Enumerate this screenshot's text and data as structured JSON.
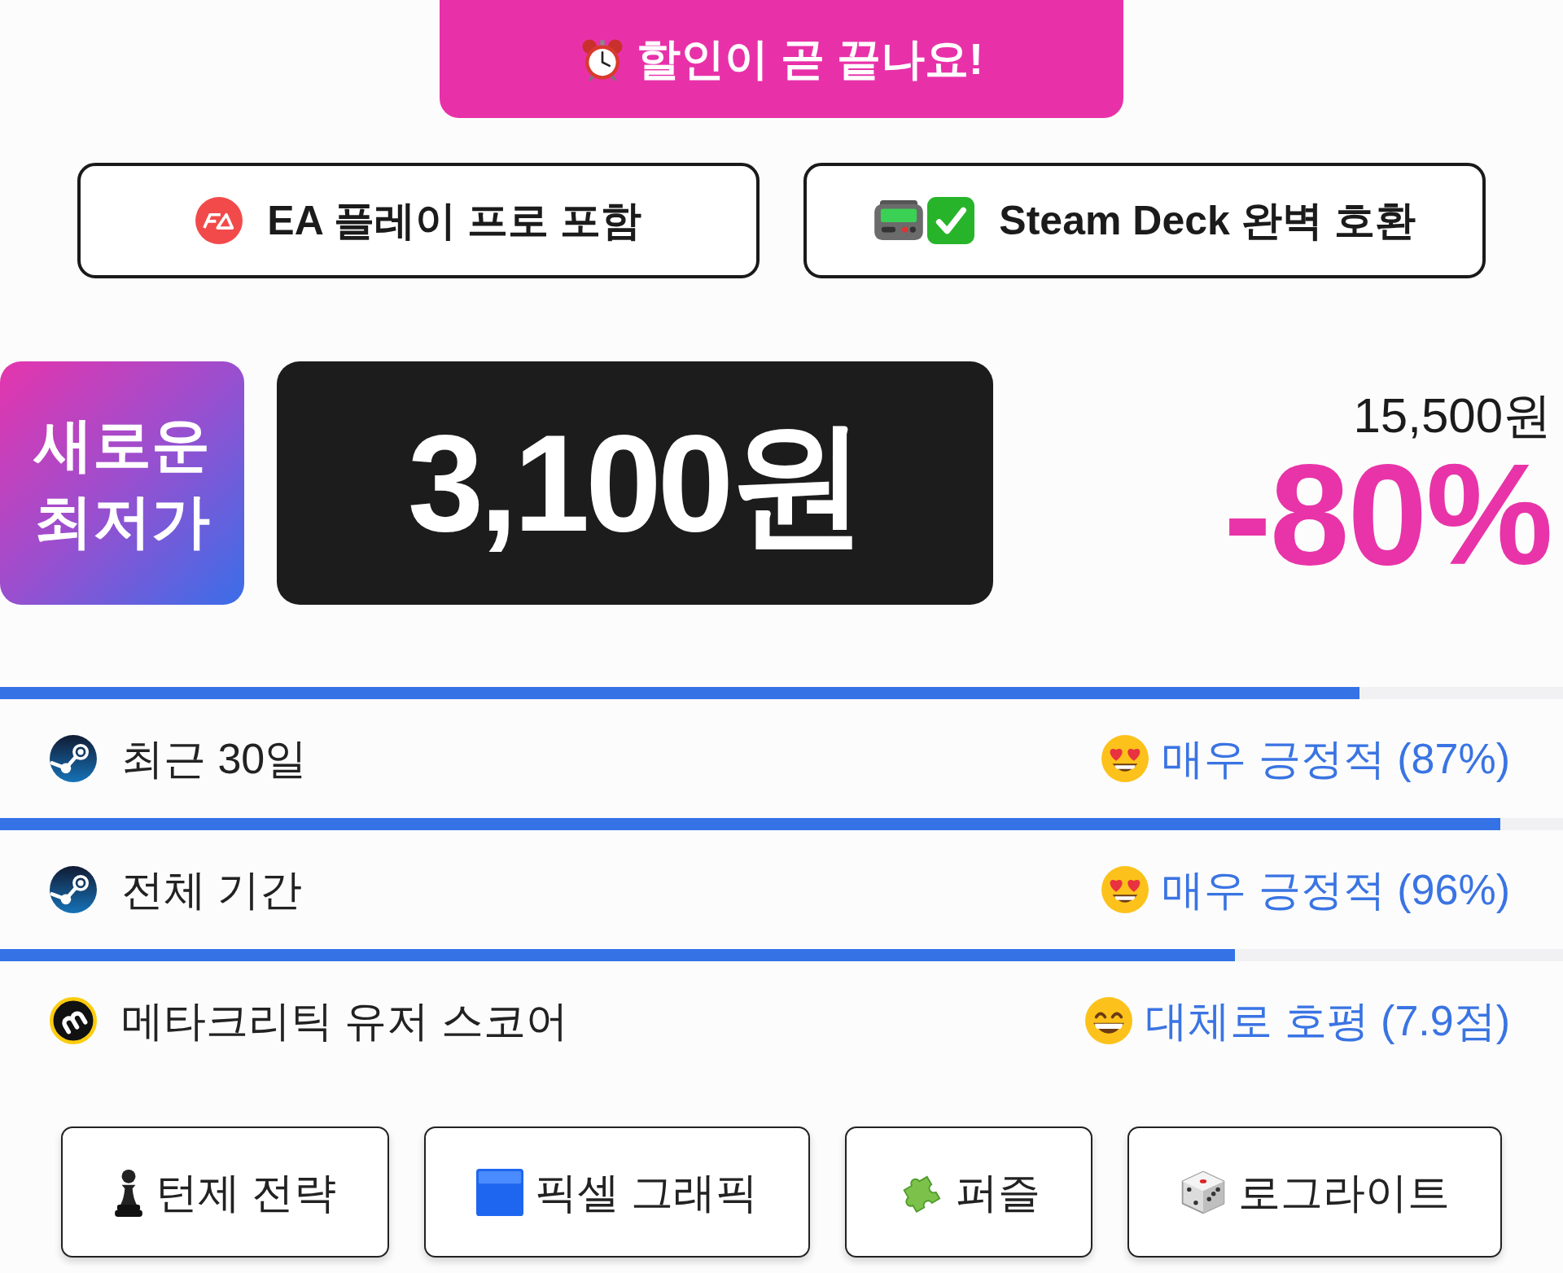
{
  "sale_banner": {
    "text": "할인이 곧 끝나요!"
  },
  "features": [
    {
      "kind": "ea",
      "text": "EA 플레이 프로 포함"
    },
    {
      "kind": "deck",
      "text": "Steam Deck 완벽 호환"
    }
  ],
  "price": {
    "badge_lines": [
      "새로운",
      "최저가"
    ],
    "current": "3,100원",
    "original": "15,500원",
    "discount": "-80%"
  },
  "reviews": [
    {
      "kind": "steam",
      "label": "최근 30일",
      "verdict": {
        "kind": "love",
        "text": "매우 긍정적 (87%)"
      },
      "level": 0.87
    },
    {
      "kind": "steam",
      "label": "전체 기간",
      "verdict": {
        "kind": "love",
        "text": "매우 긍정적 (96%)"
      },
      "level": 0.96
    },
    {
      "kind": "metacritic",
      "label": "메타크리틱 유저 스코어",
      "verdict": {
        "kind": "grin",
        "text": "대체로 호평 (7.9점)"
      },
      "level": 0.79
    }
  ],
  "tags": [
    {
      "kind": "pawn",
      "label": "턴제 전략"
    },
    {
      "kind": "square",
      "label": "픽셀 그래픽"
    },
    {
      "kind": "puzzle",
      "label": "퍼즐"
    },
    {
      "kind": "dice",
      "label": "로그라이트"
    }
  ]
}
